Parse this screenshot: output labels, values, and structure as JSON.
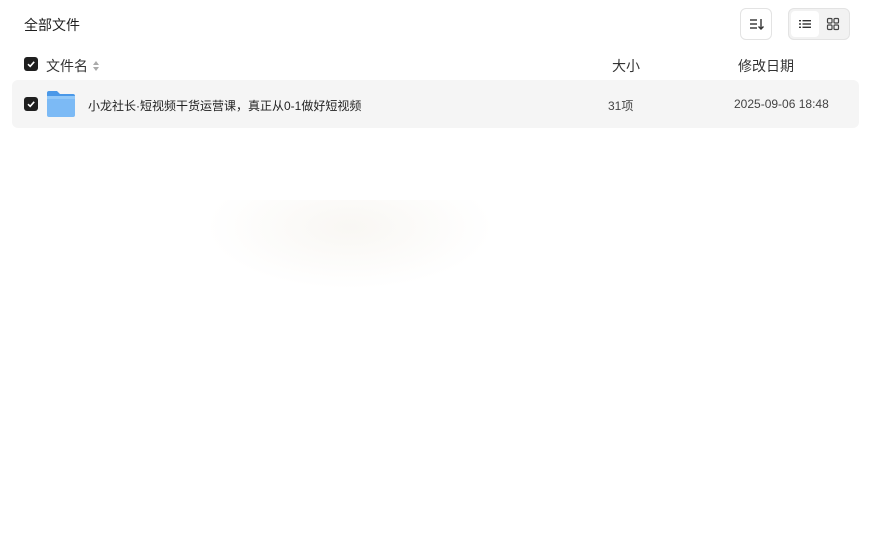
{
  "toolbar": {
    "title": "全部文件",
    "sort_icon": "sort-icon",
    "view_modes": [
      "list-view-icon",
      "grid-view-icon"
    ],
    "active_view": "list"
  },
  "table": {
    "columns": {
      "name": "文件名",
      "size": "大小",
      "date": "修改日期"
    },
    "select_all_checked": true,
    "rows": [
      {
        "checked": true,
        "icon": "folder-icon",
        "name": "小龙社长·短视频干货运营课，真正从0-1做好短视频",
        "size": "31项",
        "date": "2025-09-06 18:48"
      }
    ]
  },
  "colors": {
    "checkbox": "#1f1f1f",
    "row_highlight": "#f5f5f5",
    "folder": "#6ab0f3"
  }
}
